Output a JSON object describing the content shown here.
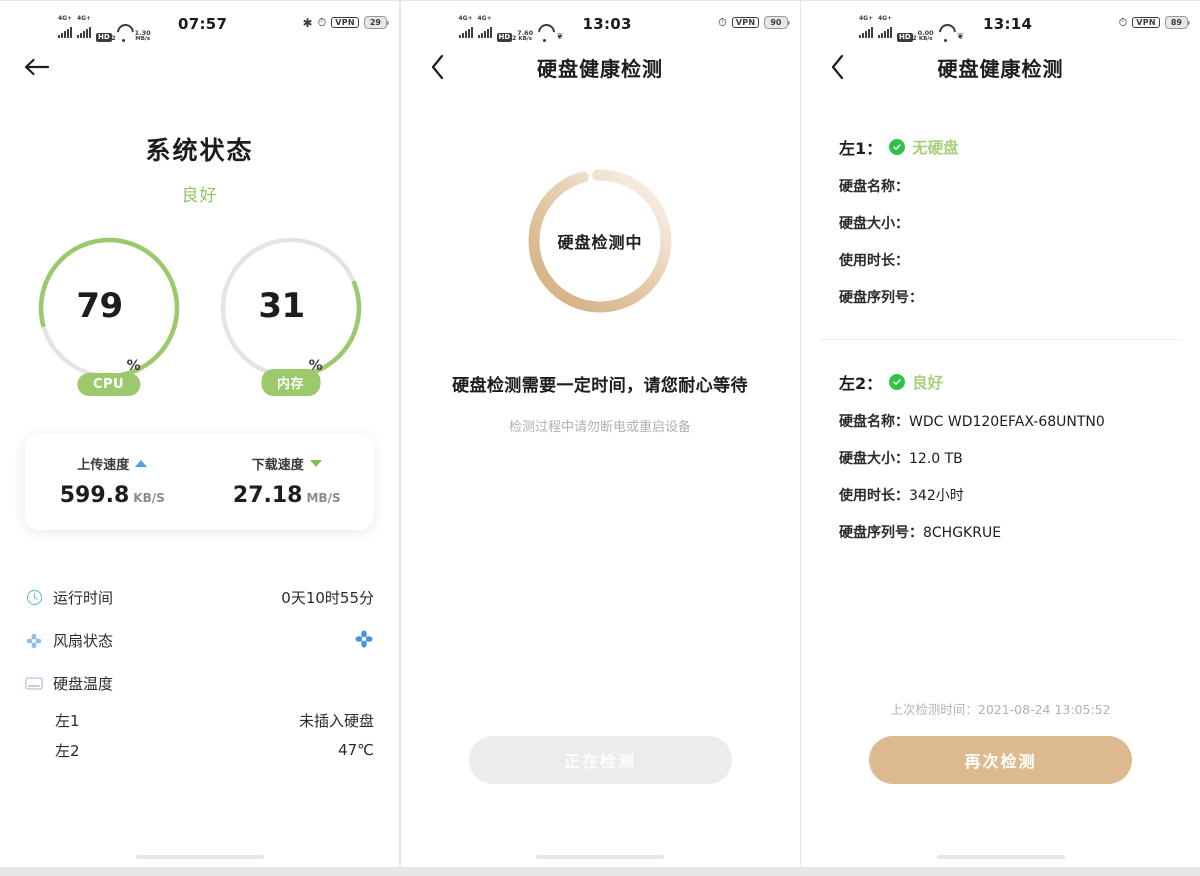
{
  "panel1": {
    "status_bar": {
      "net1": "4G+",
      "net2": "4G+",
      "hd": "HD",
      "hd_sub1": "1",
      "hd_sub2": "2",
      "speed_value": "1.30",
      "speed_unit": "MB/s",
      "time": "07:57",
      "bluetooth": "bluetooth-icon",
      "alarm": "alarm-icon",
      "vpn": "VPN",
      "battery": "29"
    },
    "back": "←",
    "title": "系统状态",
    "subtitle": "良好",
    "gauges": [
      {
        "name": "CPU",
        "value": 79,
        "unit": "%",
        "label": "CPU"
      },
      {
        "name": "memory",
        "value": 31,
        "unit": "%",
        "label": "内存"
      }
    ],
    "speed": {
      "upload": {
        "label": "上传速度",
        "value": "599.8",
        "unit": "KB/S"
      },
      "download": {
        "label": "下载速度",
        "value": "27.18",
        "unit": "MB/S"
      }
    },
    "info": [
      {
        "icon": "clock-icon",
        "label": "运行时间",
        "value": "0天10时55分"
      },
      {
        "icon": "fan-icon",
        "label": "风扇状态",
        "value": ""
      },
      {
        "icon": "disk-icon",
        "label": "硬盘温度",
        "value": ""
      }
    ],
    "temps": [
      {
        "label": "左1",
        "value": "未插入硬盘"
      },
      {
        "label": "左2",
        "value": "47℃"
      }
    ]
  },
  "panel2": {
    "status_bar": {
      "net1": "4G+",
      "net2": "4G+",
      "hd": "HD",
      "hd_sub1": "1",
      "hd_sub2": "2",
      "speed_value": "7.60",
      "speed_unit": "KB/s",
      "time": "13:03",
      "alarm": "alarm-icon",
      "vpn": "VPN",
      "battery": "90"
    },
    "back": "‹",
    "title": "硬盘健康检测",
    "spinner_text": "硬盘检测中",
    "main_text": "硬盘检测需要一定时间，请您耐心等待",
    "sub_text": "检测过程中请勿断电或重启设备",
    "button": "正在检测"
  },
  "panel3": {
    "status_bar": {
      "net1": "4G+",
      "net2": "4G+",
      "hd": "HD",
      "hd_sub1": "1",
      "hd_sub2": "2",
      "speed_value": "0.00",
      "speed_unit": "KB/s",
      "time": "13:14",
      "alarm": "alarm-icon",
      "vpn": "VPN",
      "battery": "89"
    },
    "back": "‹",
    "title": "硬盘健康检测",
    "disks": [
      {
        "slot": "左1：",
        "state": "无硬盘",
        "rows": [
          {
            "label": "硬盘名称：",
            "value": ""
          },
          {
            "label": "硬盘大小：",
            "value": ""
          },
          {
            "label": "使用时长：",
            "value": ""
          },
          {
            "label": "硬盘序列号：",
            "value": ""
          }
        ]
      },
      {
        "slot": "左2：",
        "state": "良好",
        "rows": [
          {
            "label": "硬盘名称：",
            "value": "WDC WD120EFAX-68UNTN0"
          },
          {
            "label": "硬盘大小：",
            "value": "12.0 TB"
          },
          {
            "label": "使用时长：",
            "value": "342小时"
          },
          {
            "label": "硬盘序列号：",
            "value": "8CHGKRUE"
          }
        ]
      }
    ],
    "last_check": "上次检测时间：2021-08-24 13:05:52",
    "button": "再次检测"
  },
  "colors": {
    "green": "#9cc96b",
    "green_text": "#94c45f",
    "tan": "#ddba8f",
    "tan_ring": "#d8b286",
    "check_green": "#2fc14a",
    "upload_blue": "#4da2e8",
    "download_green": "#7dc24f",
    "track_grey": "#e6e4e2"
  }
}
